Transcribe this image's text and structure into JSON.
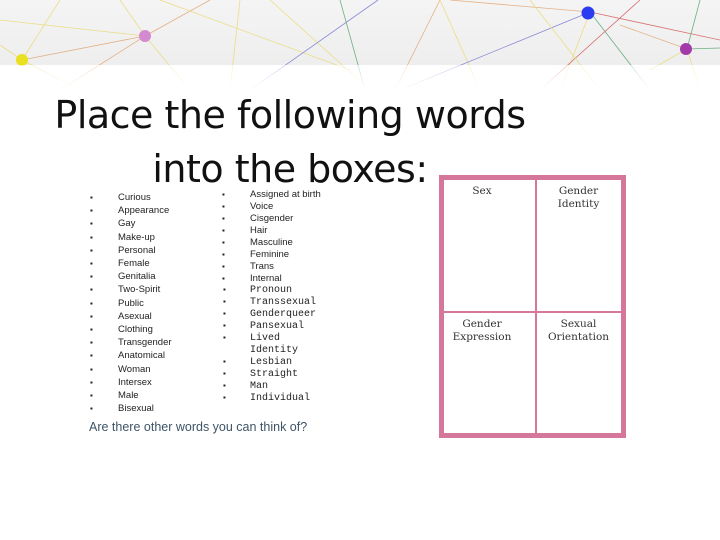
{
  "slide": {
    "title_line1": "Place the following words",
    "title_line2": "into the boxes:",
    "bullet_glyph": "▪",
    "list_left": [
      "Curious",
      "Appearance",
      "Gay",
      "Make-up",
      "Personal",
      "Female",
      "Genitalia",
      "Two-Spirit",
      "Public",
      "Asexual",
      "Clothing",
      "Transgender",
      "Anatomical",
      "Woman",
      "Intersex",
      "Male",
      "Bisexual"
    ],
    "list_right": [
      "Assigned at birth",
      "Voice",
      "Cisgender",
      "Hair",
      "Masculine",
      "Feminine",
      "Trans",
      "Internal",
      "Pronoun",
      "Transsexual",
      "Genderqueer",
      "Pansexual",
      "Lived",
      "Identity",
      "Lesbian",
      "Straight",
      "Man",
      "Individual"
    ],
    "question": "Are there other words you can think of?",
    "grid": {
      "top_left": "Sex",
      "top_right_1": "Gender",
      "top_right_2": "Identity",
      "bottom_left_1": "Gender",
      "bottom_left_2": "Expression",
      "bottom_right_1": "Sexual",
      "bottom_right_2": "Orientation"
    },
    "colors": {
      "frame": "#d4779a",
      "question_text": "#3e5466"
    }
  }
}
